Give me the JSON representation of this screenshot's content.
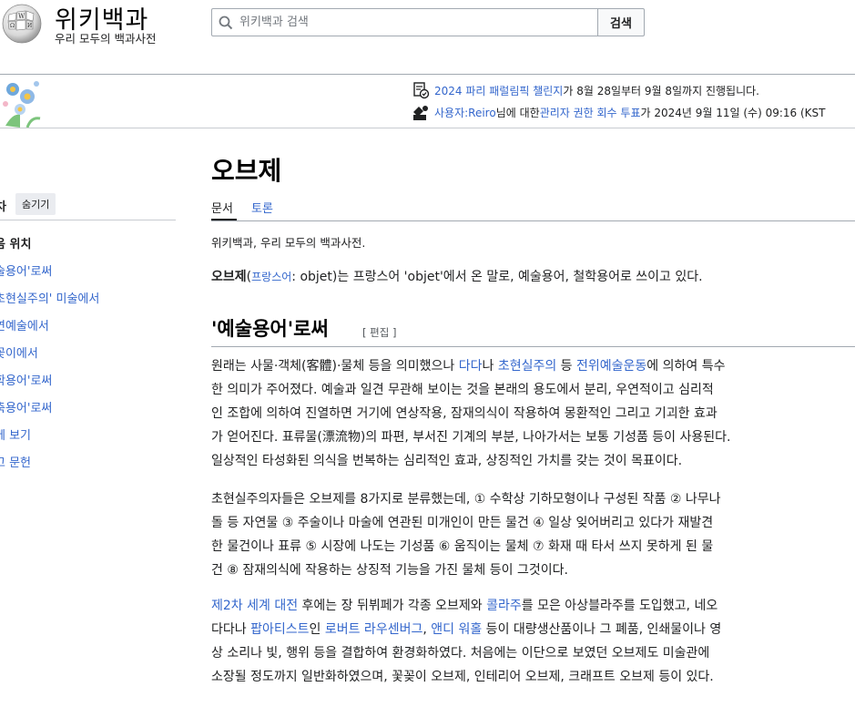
{
  "header": {
    "logo_title": "위키백과",
    "logo_tagline": "우리 모두의 백과사전",
    "search_placeholder": "위키백과 검색",
    "search_button": "검색"
  },
  "banner": {
    "notice1": {
      "link": "2024 파리 패럴림픽 챌린지",
      "rest": "가 8월 28일부터 9월 8일까지 진행됩니다."
    },
    "notice2": {
      "link1": "사용자:Reiro",
      "mid": "님에 대한 ",
      "link2": "관리자 권한 회수 투표",
      "rest": "가 2024년 9월 11일 (수) 09:16 (KST"
    }
  },
  "toc": {
    "title": "차",
    "hide_label": "숨기기",
    "items": [
      {
        "label": "음 위치",
        "top": true
      },
      {
        "label": "술용어'로써"
      },
      {
        "label": "초현실주의' 미술에서"
      },
      {
        "label": "연예술에서"
      },
      {
        "label": "꽃이에서"
      },
      {
        "label": "학용어'로써"
      },
      {
        "label": "축용어'로써"
      },
      {
        "label": "께 보기"
      },
      {
        "label": "고 문헌"
      }
    ]
  },
  "article": {
    "title": "오브제",
    "tab_article": "문서",
    "tab_talk": "토론",
    "site_sub": "위키백과, 우리 모두의 백과사전.",
    "intro": {
      "bold": "오브제",
      "paren_open": "(",
      "lang_link": "프랑스어",
      "lang_colon": ": objet",
      "rest": ")는 프랑스어 'objet'에서 온 말로, 예술용어, 철학용어로 쓰이고 있다."
    },
    "section1": {
      "heading": "'예술용어'로써",
      "edit": "[ 편집 ]"
    },
    "p1": {
      "l1a": "원래는 사물·객체(客體)·물체 등을 의미했으나 ",
      "l1b": "다다",
      "l1c": "나 ",
      "l1d": "초현실주의",
      "l1e": " 등 ",
      "l1f": "전위예술운동",
      "l1g": "에 의하여 특수",
      "l2": "한 의미가 주어졌다. 예술과 일견 무관해 보이는 것을 본래의 용도에서 분리, 우연적이고 심리적",
      "l3": "인 조합에 의하여 진열하면 거기에 연상작용, 잠재의식이 작용하여 몽환적인 그리고 기괴한 효과",
      "l4": "가 얻어진다. 표류물(漂流物)의 파편, 부서진 기계의 부분, 나아가서는 보통 기성품 등이 사용된다.",
      "l5": "일상적인 타성화된 의식을 번복하는 심리적인 효과, 상징적인 가치를 갖는 것이 목표이다."
    },
    "p2": {
      "l1": "초현실주의자들은 오브제를 8가지로 분류했는데, ① 수학상 기하모형이나 구성된 작품 ② 나무나",
      "l2": "돌 등 자연물 ③ 주술이나 마술에 연관된 미개인이 만든 물건 ④ 일상 잊어버리고 있다가 재발견",
      "l3": "한 물건이나 표류 ⑤ 시장에 나도는 기성품 ⑥ 움직이는 물체 ⑦ 화재 때 타서 쓰지 못하게 된 물",
      "l4": "건 ⑧ 잠재의식에 작용하는 상징적 기능을 가진 물체 등이 그것이다."
    },
    "p3": {
      "l1a": "제2차 세계 대전",
      "l1b": " 후에는 장 뒤뷔페가 각종 오브제와 ",
      "l1c": "콜라주",
      "l1d": "를 모은 아상블라주를 도입했고, 네오",
      "l2a": "다다나 ",
      "l2b": "팝아티스트",
      "l2c": "인 ",
      "l2d": "로버트 라우센버그",
      "l2e": ", ",
      "l2f": "앤디 워홀",
      "l2g": " 등이 대량생산품이나 그 폐품, 인쇄물이나 영",
      "l3": "상 소리나 빛, 행위 등을 결합하여 환경화하였다. 처음에는 이단으로 보였던 오브제도 미술관에",
      "l4": "소장될 정도까지 일반화하였으며, 꽃꽂이 오브제, 인테리어 오브제, 크래프트 오브제 등이 있다."
    }
  }
}
